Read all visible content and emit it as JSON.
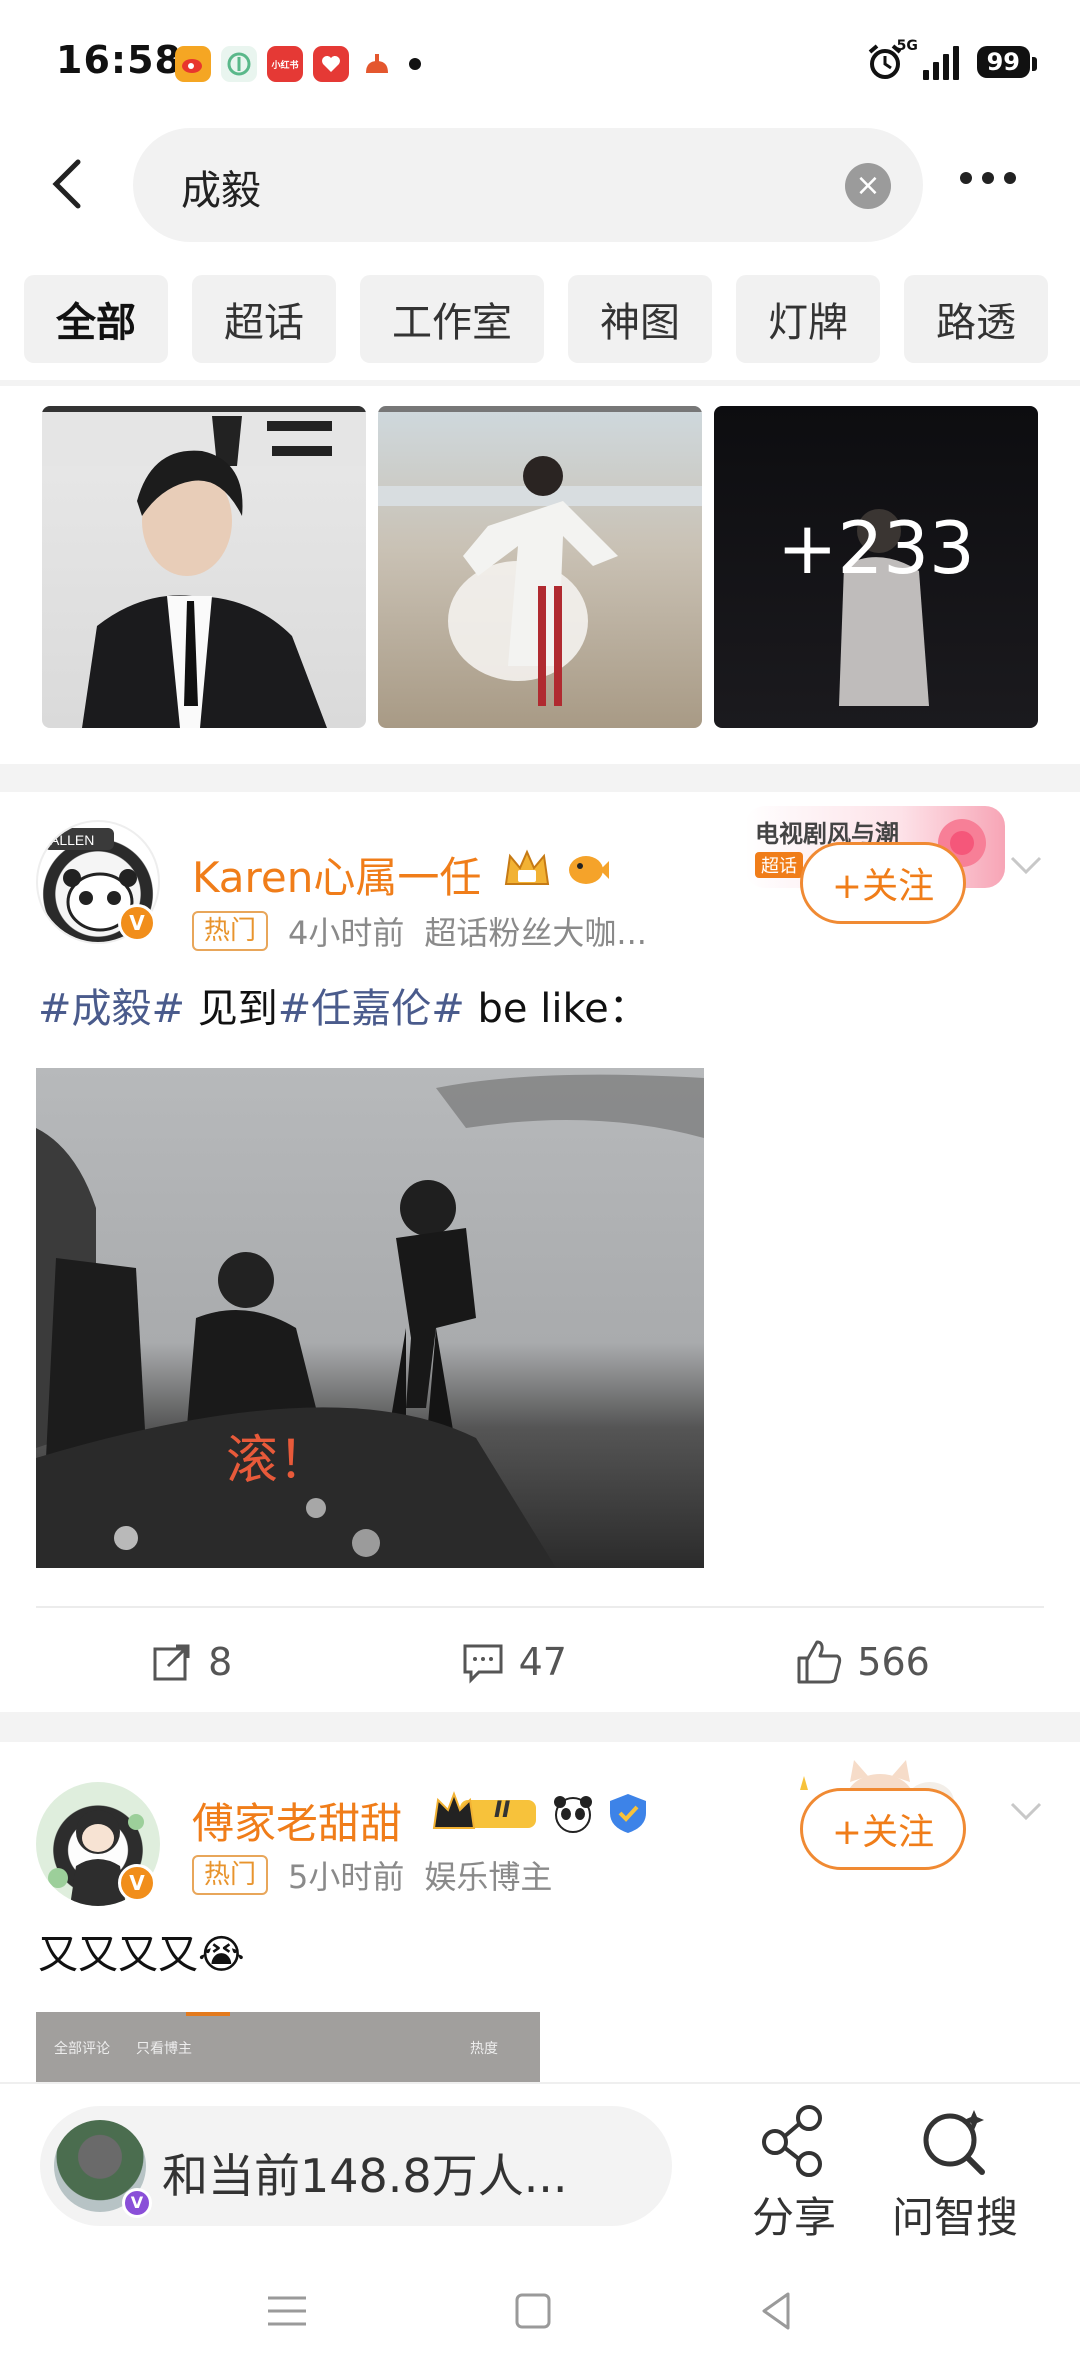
{
  "status_bar": {
    "time": "16:58",
    "network": "5G",
    "battery": "99",
    "apps": [
      {
        "icon": "weibo-icon",
        "color": "#f5a623"
      },
      {
        "icon": "app-green-icon",
        "color": "#5ab88a"
      },
      {
        "icon": "xiaohongshu-icon",
        "color": "#e53935",
        "label": "小红书"
      },
      {
        "icon": "app-red-icon",
        "color": "#e53935"
      },
      {
        "icon": "app-orange-icon",
        "color": "#e4572e"
      }
    ]
  },
  "search": {
    "query": "成毅"
  },
  "tabs": [
    {
      "label": "全部",
      "active": true
    },
    {
      "label": "超话",
      "active": false
    },
    {
      "label": "工作室",
      "active": false
    },
    {
      "label": "神图",
      "active": false
    },
    {
      "label": "灯牌",
      "active": false
    },
    {
      "label": "路透",
      "active": false
    }
  ],
  "gallery": {
    "more_count": "+233"
  },
  "posts": [
    {
      "username": "Karen心属一任",
      "hot_tag": "热门",
      "time": "4小时前",
      "source": "超话粉丝大咖...",
      "follow_label": "+关注",
      "decor_text": "电视剧风与潮",
      "decor_tag": "超话",
      "text_parts": [
        "#成毅#",
        " 见到",
        "#任嘉伦#",
        " be like："
      ],
      "image_caption": "滚！",
      "repost_count": "8",
      "comment_count": "47",
      "like_count": "566"
    },
    {
      "username": "傅家老甜甜",
      "level": "II",
      "hot_tag": "热门",
      "time": "5小时前",
      "source": "娱乐博主",
      "follow_label": "+关注",
      "text": "又又又又😭",
      "comment_tabs": [
        "全部评论",
        "只看博主"
      ],
      "sort_label": "热度"
    }
  ],
  "bottom_bar": {
    "chat_text": "和当前148.8万人...",
    "share_label": "分享",
    "smart_search_label": "问智搜"
  },
  "colors": {
    "accent": "#f07d19",
    "hashtag": "#4a5b8c",
    "hot_tag": "#e8942d"
  }
}
